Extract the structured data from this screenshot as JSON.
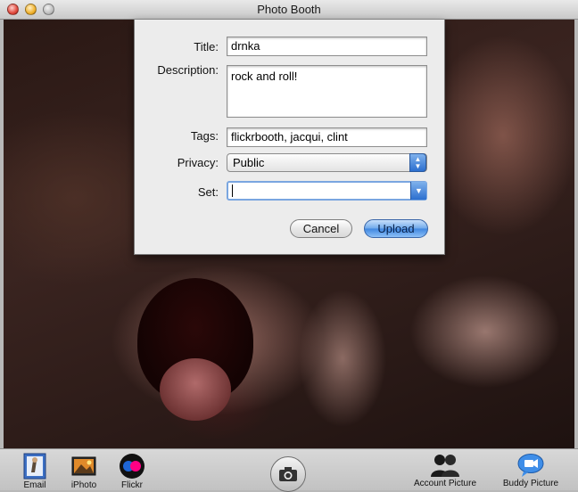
{
  "window": {
    "title": "Photo Booth"
  },
  "upload_sheet": {
    "title_label": "Title:",
    "title_value": "drnka",
    "description_label": "Description:",
    "description_value": "rock and roll!",
    "tags_label": "Tags:",
    "tags_value": "flickrbooth, jacqui, clint",
    "privacy_label": "Privacy:",
    "privacy_value": "Public",
    "set_label": "Set:",
    "set_value": "",
    "cancel_label": "Cancel",
    "upload_label": "Upload"
  },
  "toolbar": {
    "email_label": "Email",
    "iphoto_label": "iPhoto",
    "flickr_label": "Flickr",
    "account_picture_label": "Account Picture",
    "buddy_picture_label": "Buddy Picture"
  },
  "icons": {
    "close": "close-icon",
    "minimize": "minimize-icon",
    "zoom": "zoom-icon",
    "email": "envelope-stamp-icon",
    "iphoto": "iphoto-icon",
    "flickr": "flickr-icon",
    "shutter": "camera-icon",
    "account_picture": "people-icon",
    "buddy_picture": "video-chat-icon"
  },
  "colors": {
    "accent": "#3f86e0",
    "photo_dark": "#2a1814"
  }
}
